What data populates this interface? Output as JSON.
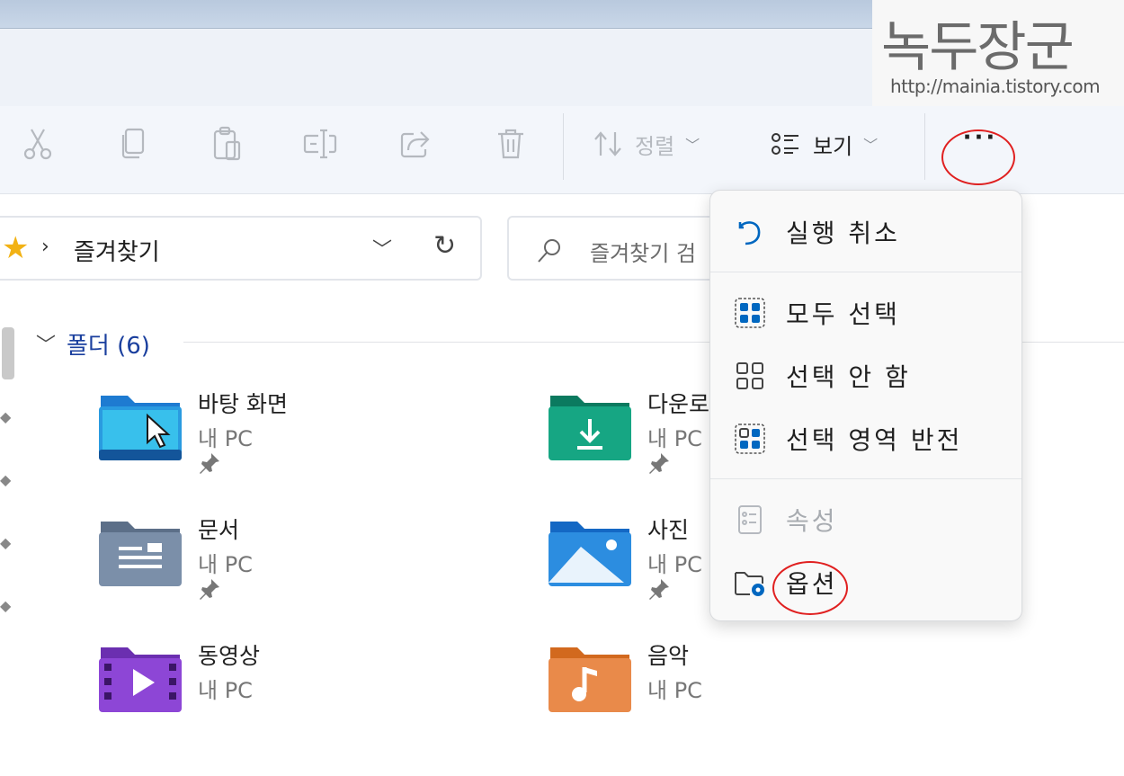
{
  "watermark": {
    "title": "녹두장군",
    "url": "http://mainia.tistory.com"
  },
  "toolbar": {
    "cut_icon": "scissors-icon",
    "copy_icon": "copy-icon",
    "paste_icon": "paste-icon",
    "rename_icon": "rename-icon",
    "share_icon": "share-icon",
    "delete_icon": "trash-icon",
    "sort_label": "정렬",
    "view_label": "보기",
    "more_label": "···"
  },
  "address": {
    "crumb": "즐겨찾기",
    "star_color": "#f2b215"
  },
  "search": {
    "placeholder": "즐겨찾기 검"
  },
  "group": {
    "title": "폴더 (6)"
  },
  "folders": [
    {
      "name": "바탕 화면",
      "location": "내 PC",
      "pinned": true,
      "icon": "desktop-folder-icon"
    },
    {
      "name": "다운로",
      "location": "내 PC",
      "pinned": true,
      "icon": "downloads-folder-icon"
    },
    {
      "name": "문서",
      "location": "내 PC",
      "pinned": true,
      "icon": "documents-folder-icon"
    },
    {
      "name": "사진",
      "location": "내 PC",
      "pinned": true,
      "icon": "pictures-folder-icon"
    },
    {
      "name": "동영상",
      "location": "내 PC",
      "pinned": false,
      "icon": "videos-folder-icon"
    },
    {
      "name": "음악",
      "location": "내 PC",
      "pinned": false,
      "icon": "music-folder-icon"
    }
  ],
  "menu": {
    "undo": "실행 취소",
    "select_all": "모두 선택",
    "select_none": "선택 안 함",
    "invert_selection": "선택 영역 반전",
    "properties": "속성",
    "options": "옵션"
  },
  "colors": {
    "accent": "#0067c0",
    "highlight_circle": "#e02020"
  }
}
